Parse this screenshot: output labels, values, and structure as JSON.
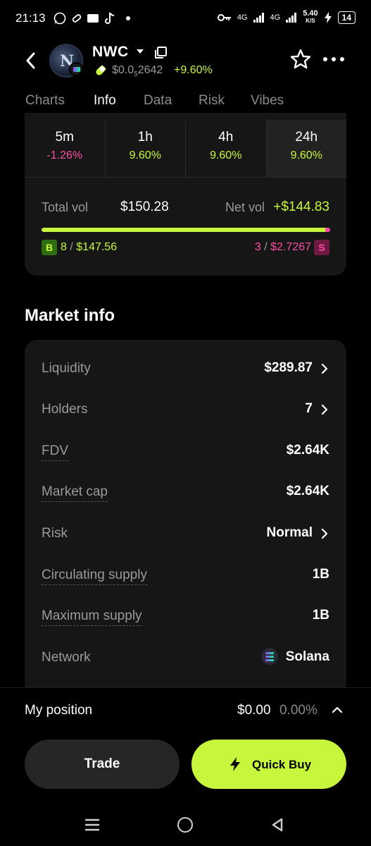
{
  "status_bar": {
    "time": "21:13",
    "network_1": "4G",
    "network_2": "4G",
    "speed": "5.40",
    "speed_unit": "K/S",
    "battery": "14"
  },
  "header": {
    "symbol": "NWC",
    "price_prefix": "$0.0",
    "price_subscript": "5",
    "price_digits": "2642",
    "change": "+9.60%",
    "avatar_letter": "N"
  },
  "tabs": [
    "Charts",
    "Info",
    "Data",
    "Risk",
    "Vibes"
  ],
  "active_tab": "Info",
  "timeframes": [
    {
      "label": "5m",
      "value": "-1.26%",
      "trend": "neg"
    },
    {
      "label": "1h",
      "value": "9.60%",
      "trend": "pos"
    },
    {
      "label": "4h",
      "value": "9.60%",
      "trend": "pos"
    },
    {
      "label": "24h",
      "value": "9.60%",
      "trend": "pos"
    }
  ],
  "volume": {
    "total_label": "Total vol",
    "total_value": "$150.28",
    "net_label": "Net vol",
    "net_value": "+$144.83",
    "buy_fraction": 0.982,
    "buy_badge": "B",
    "buy_count": "8",
    "buy_amount": "$147.56",
    "sell_badge": "S",
    "sell_count": "3",
    "sell_amount": "$2.7267",
    "separator": "/"
  },
  "market_info": {
    "title": "Market info",
    "rows": [
      {
        "label": "Liquidity",
        "value": "$289.87"
      },
      {
        "label": "Holders",
        "value": "7"
      },
      {
        "label": "FDV",
        "value": "$2.64K"
      },
      {
        "label": "Market cap",
        "value": "$2.64K"
      },
      {
        "label": "Risk",
        "value": "Normal"
      },
      {
        "label": "Circulating supply",
        "value": "1B"
      },
      {
        "label": "Maximum supply",
        "value": "1B"
      },
      {
        "label": "Network",
        "value": "Solana"
      }
    ]
  },
  "position": {
    "label": "My position",
    "value": "$0.00",
    "pct": "0.00%"
  },
  "actions": {
    "trade": "Trade",
    "quick_buy": "Quick Buy"
  },
  "colors": {
    "accent_green": "#c7f73d",
    "accent_pink": "#ff4fa3",
    "card_bg": "#161616",
    "muted": "#9a9a9a"
  }
}
